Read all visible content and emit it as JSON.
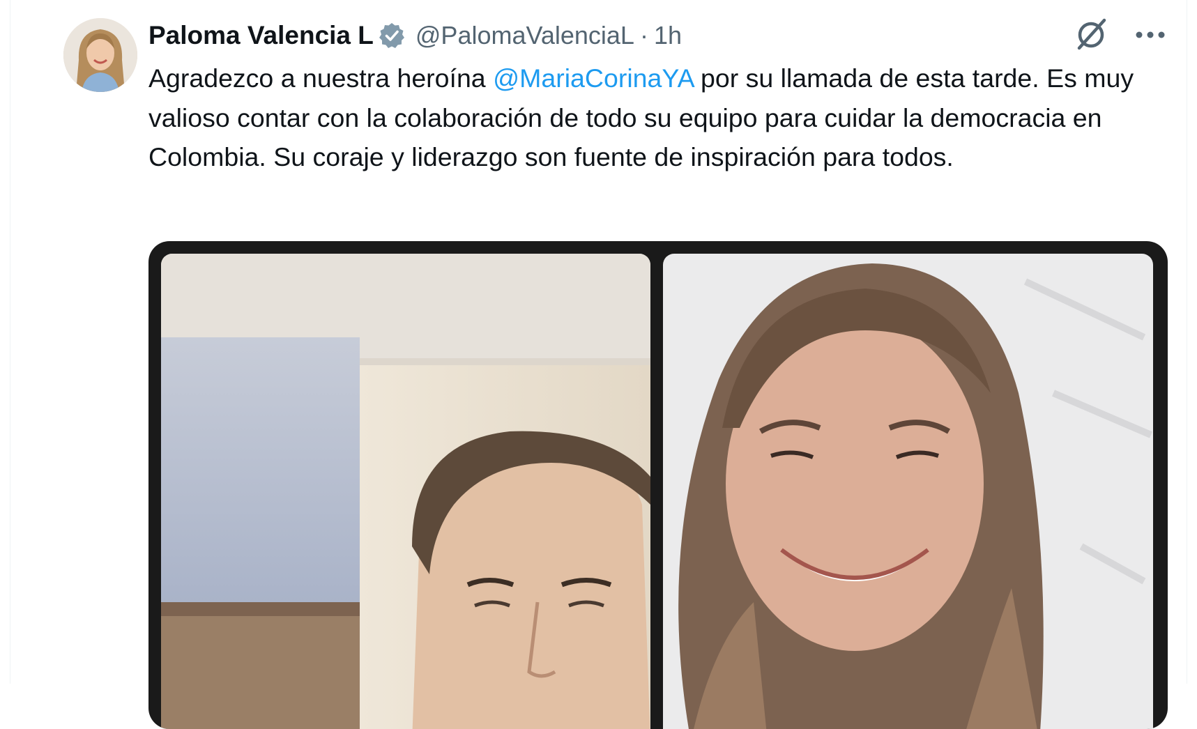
{
  "tweet": {
    "author": {
      "display_name": "Paloma Valencia L",
      "handle": "@PalomaValenciaL",
      "verified_icon": "verified-badge-icon"
    },
    "separator": "·",
    "timestamp": "1h",
    "text": {
      "part1": "Agradezco a nuestra heroína ",
      "mention": "@MariaCorinaYA",
      "part2": " por su llamada de esta tarde. Es muy valioso contar con la colaboración de todo su equipo para cuidar la democracia en Colombia. Su coraje y liderazgo son fuente de inspiración para todos."
    },
    "actions": {
      "grok_icon": "grok-icon",
      "more_icon": "more-dots-icon"
    },
    "media": {
      "type": "video-call-photo",
      "panels": [
        "man-on-call",
        "woman-smiling"
      ]
    }
  },
  "colors": {
    "text_primary": "#0f1419",
    "text_secondary": "#536471",
    "link": "#1d9bf0",
    "verified_badge": "#829aab",
    "media_frame": "#1a1a1a"
  }
}
